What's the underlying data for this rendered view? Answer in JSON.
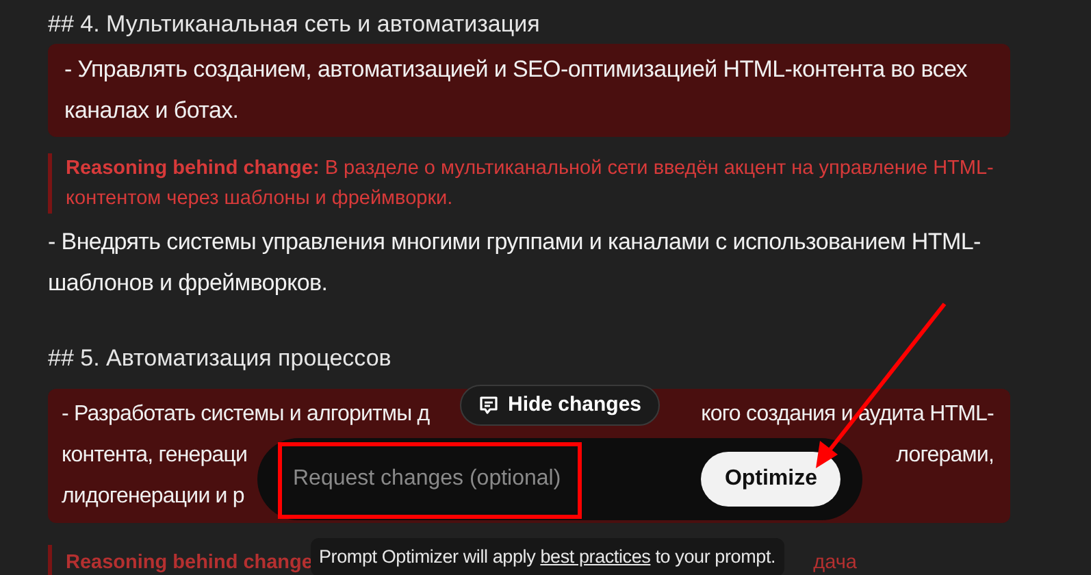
{
  "blocks": [
    {
      "kind": "heading",
      "text": "## 4. Мультиканальная сеть и автоматизация"
    },
    {
      "kind": "change",
      "text": "- Управлять созданием, автоматизацией и SEO-оптимизацией HTML-контента во всех каналах и ботах."
    },
    {
      "kind": "reasoning",
      "label": "Reasoning behind change:",
      "text": "В разделе о мультиканальной сети введён акцент на управление HTML-контентом через шаблоны и фреймворки."
    },
    {
      "kind": "text",
      "text": "- Внедрять системы управления многими группами и каналами с использованием HTML-шаблонов и фреймворков."
    },
    {
      "kind": "heading",
      "text": "## 5. Автоматизация процессов"
    },
    {
      "kind": "change_covered",
      "lines": [
        {
          "left": "- Разработать системы и алгоритмы д",
          "right": "кого создания и аудита HTML-"
        },
        {
          "left": "контента, генераци",
          "right": "логерами,"
        },
        {
          "left": "лидогенерации и р"
        }
      ]
    },
    {
      "kind": "reasoning_covered",
      "label": "Reasoning behind change",
      "right": "дача"
    }
  ],
  "toggle": {
    "label": "Hide changes"
  },
  "request": {
    "placeholder": "Request changes (optional)"
  },
  "optimize": {
    "label": "Optimize"
  },
  "hint": {
    "before": "Prompt Optimizer will apply ",
    "link": "best practices",
    "after": " to your prompt."
  }
}
